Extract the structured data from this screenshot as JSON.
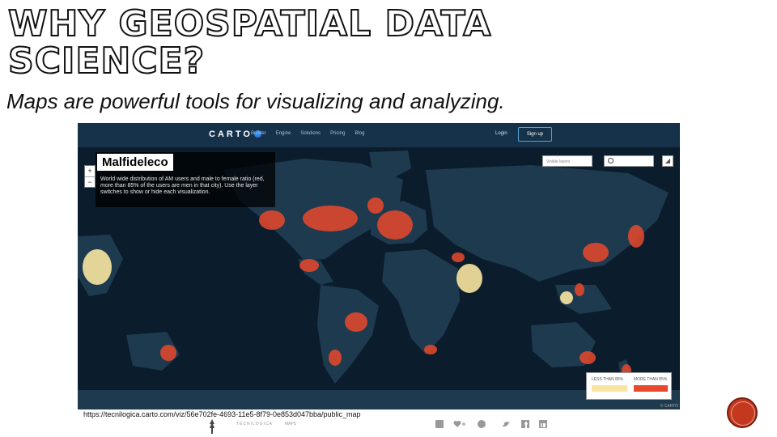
{
  "slide": {
    "title_line1": "WHY GEOSPATIAL DATA",
    "title_line2": "SCIENCE?",
    "subtitle": "Maps are powerful tools for visualizing and analyzing.",
    "url": "https://tecnilogica.carto.com/viz/56e702fe-4693-11e5-8f79-0e853d047bba/public_map"
  },
  "carto": {
    "brand": "CARTO",
    "nav": [
      "Builder",
      "Engine",
      "Solutions",
      "Pricing",
      "Blog"
    ],
    "login": "Login",
    "signup": "Sign up",
    "map_title": "Malfideleco",
    "map_description": "World wide distribution of AM users and male to female ratio (red, more than 85% of the users are men in that city). Use the layer switches to show or hide each visualization.",
    "layers_placeholder": "Visible layers",
    "legend_left": "LESS THAN 85%",
    "legend_right": "MORE THAN 85%",
    "attribution": "© CARTO",
    "zoom_in": "+",
    "zoom_out": "−",
    "share": "◢"
  },
  "footer": {
    "brand": "TECNILOGICA",
    "maps": "MAPS",
    "icons": [
      "rss-icon",
      "heart-icon",
      "circle-icon",
      "twitter-icon",
      "facebook-icon",
      "linkedin-icon"
    ]
  },
  "colors": {
    "ocean": "#0b1d2c",
    "land": "#1e3a4f",
    "hot": "#e8492c",
    "warm": "#f8e6a0",
    "accent": "#c4381f"
  }
}
